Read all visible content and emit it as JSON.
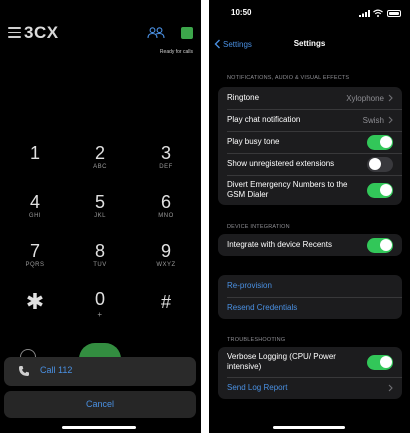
{
  "dialer": {
    "logo_prefix": "3C",
    "logo_suffix": "X",
    "status_text": "Ready for calls",
    "keys": [
      {
        "digit": "1",
        "letters": ""
      },
      {
        "digit": "2",
        "letters": "ABC"
      },
      {
        "digit": "3",
        "letters": "DEF"
      },
      {
        "digit": "4",
        "letters": "GHI"
      },
      {
        "digit": "5",
        "letters": "JKL"
      },
      {
        "digit": "6",
        "letters": "MNO"
      },
      {
        "digit": "7",
        "letters": "PQRS"
      },
      {
        "digit": "8",
        "letters": "TUV"
      },
      {
        "digit": "9",
        "letters": "WXYZ"
      },
      {
        "digit": "✱",
        "letters": ""
      },
      {
        "digit": "0",
        "letters": "+"
      },
      {
        "digit": "#",
        "letters": ""
      }
    ],
    "call_label": "Call 112",
    "cancel_label": "Cancel",
    "accent": "#4a90e2",
    "green": "#3ca64b"
  },
  "settings": {
    "time": "10:50",
    "back_label": "Settings",
    "title": "Settings",
    "sections": {
      "notifications": {
        "header": "NOTIFICATIONS, AUDIO & VISUAL EFFECTS",
        "ringtone_label": "Ringtone",
        "ringtone_value": "Xylophone",
        "chat_label": "Play chat notification",
        "chat_value": "Swish",
        "busy_label": "Play busy tone",
        "busy_on": true,
        "unregistered_label": "Show unregistered extensions",
        "unregistered_on": false,
        "divert_label": "Divert Emergency Numbers to the GSM Dialer",
        "divert_on": true
      },
      "device": {
        "header": "DEVICE INTEGRATION",
        "recents_label": "Integrate with device Recents",
        "recents_on": true
      },
      "credentials": {
        "reprovision_label": "Re-provision",
        "resend_label": "Resend Credentials"
      },
      "troubleshooting": {
        "header": "TROUBLESHOOTING",
        "verbose_label": "Verbose Logging (CPU/ Power intensive)",
        "verbose_on": true,
        "send_log_label": "Send Log Report"
      }
    },
    "toggle_on_color": "#32c759",
    "link_color": "#4a90e2"
  }
}
